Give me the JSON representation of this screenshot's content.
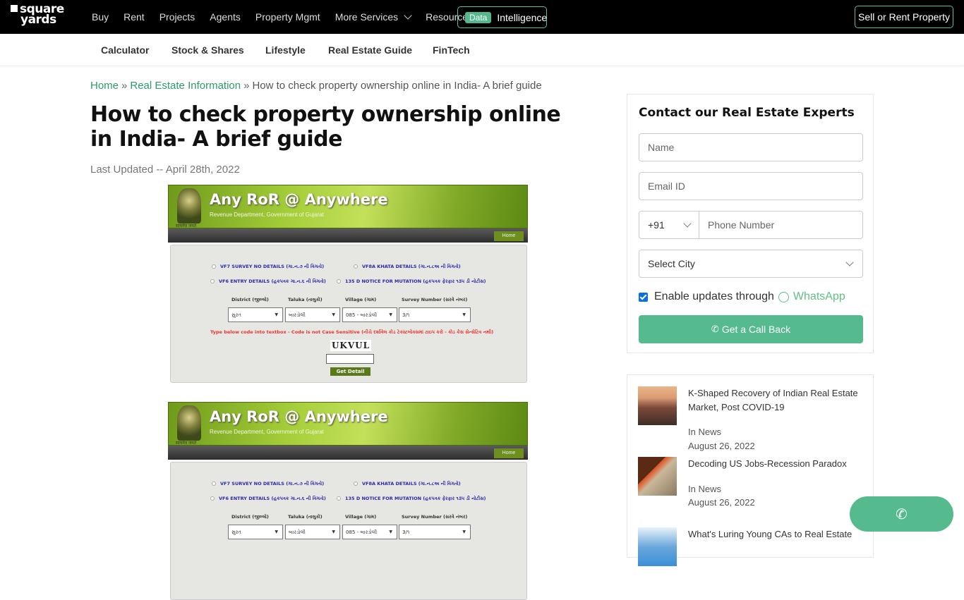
{
  "header": {
    "logo_line1": "square",
    "logo_line2": "yards",
    "nav": [
      "Buy",
      "Rent",
      "Projects",
      "Agents",
      "Property Mgmt",
      "More Services",
      "Resources"
    ],
    "data_badge": "Data",
    "data_label": "Intelligence",
    "sell_button": "Sell or Rent Property"
  },
  "subnav": [
    "Calculator",
    "Stock & Shares",
    "Lifestyle",
    "Real Estate Guide",
    "FinTech"
  ],
  "breadcrumb": {
    "home": "Home",
    "sep": "»",
    "section": "Real Estate Information",
    "current": "How to check property ownership online in India- A brief guide"
  },
  "article": {
    "title": "How to check property ownership online in India- A brief guide",
    "updated": "Last Updated -- April 28th, 2022"
  },
  "ror_image": {
    "title": "Any RoR @ Anywhere",
    "subtitle": "Revenue Department, Government of Gujarat",
    "emblem_caption": "सत्यमेव जयते",
    "home": "Home",
    "options": [
      "VF7 SURVEY NO DETAILS (ગા.ન.૭ ની વિગતો)",
      "VF8A KHATA DETAILS (ગા.ન.૮અ ની વિગતો)",
      "VF6 ENTRY DETAILS (હકપત્રક ગા.ન.૬ ની વિગતો)",
      "135 D NOTICE FOR MUTATION (હકપત્રક ફેરફાર ૧૩૫ ડી નોટીસ)"
    ],
    "labels": [
      "District (જીલ્લો)",
      "Taluka (તાલુકો)",
      "Village (ગામ)",
      "Survey Number (સરવે નંબર)"
    ],
    "values": [
      "સુરત",
      "બારડોલી",
      "085 - બારડોલી",
      "3/૧"
    ],
    "warning": "Type below code into textbox - Code is not Case Sensitive (નીચે દર્શાવેલ કોડ ટેક્સ્ટબોક્સમાં ટાઇપ કરો - કોડ કેસ સેન્સેટિવ નથી)",
    "captcha": "UKVUL",
    "button": "Get Detail"
  },
  "contact": {
    "heading": "Contact our Real Estate Experts",
    "name_placeholder": "Name",
    "email_placeholder": "Email ID",
    "country_code": "+91",
    "phone_placeholder": "Phone Number",
    "city_select": "Select City",
    "whatsapp_prefix": "Enable updates through",
    "whatsapp_label": "WhatsApp",
    "whatsapp_checked": true,
    "callback_button": "Get a Call Back"
  },
  "articles": [
    {
      "title": "K-Shaped Recovery of Indian Real Estate Market, Post COVID-19",
      "category": "In News",
      "date": "August 26, 2022"
    },
    {
      "title": "Decoding US Jobs-Recession Paradox",
      "category": "In News",
      "date": "August 26, 2022"
    },
    {
      "title": "What's Luring Young CAs to Real Estate",
      "category": "",
      "date": ""
    }
  ],
  "colors": {
    "accent": "#55bb8f",
    "link": "#2e9a6a",
    "topbar": "#000000"
  }
}
